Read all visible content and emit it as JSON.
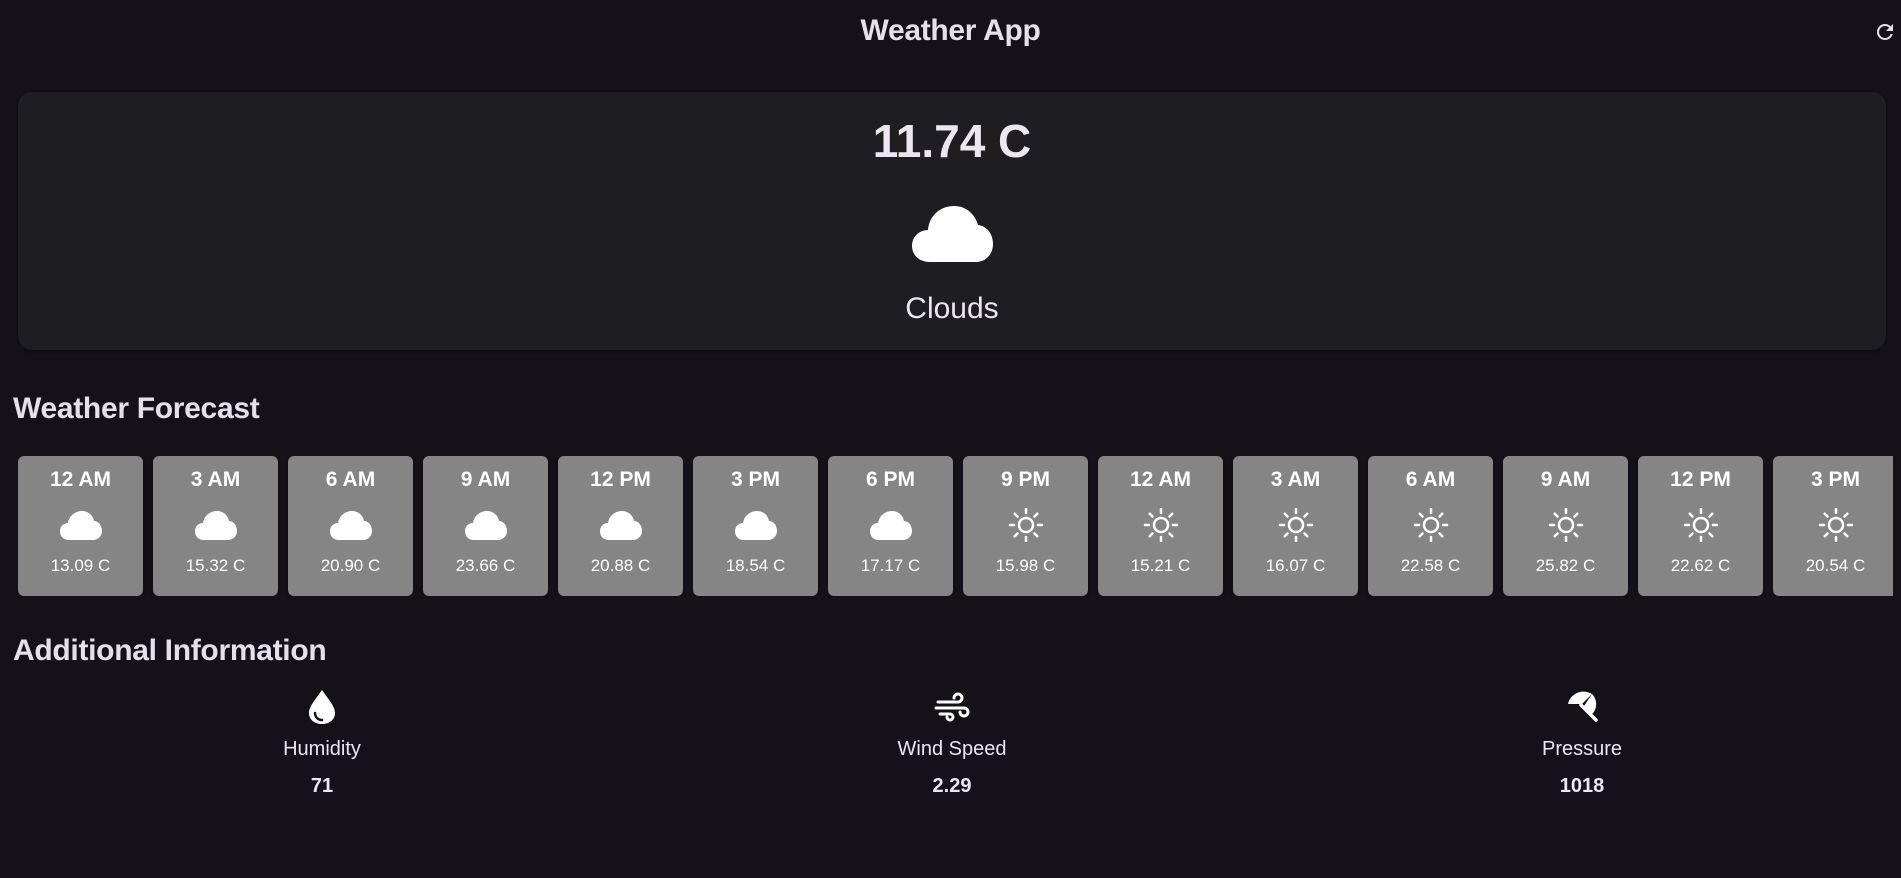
{
  "app": {
    "title": "Weather App"
  },
  "current": {
    "temperature": "11.74 C",
    "condition": "Clouds",
    "icon": "cloud-icon"
  },
  "forecast": {
    "title": "Weather Forecast",
    "items": [
      {
        "time": "12 AM",
        "icon": "cloud",
        "temp": "13.09 C"
      },
      {
        "time": "3 AM",
        "icon": "cloud",
        "temp": "15.32 C"
      },
      {
        "time": "6 AM",
        "icon": "cloud",
        "temp": "20.90 C"
      },
      {
        "time": "9 AM",
        "icon": "cloud",
        "temp": "23.66 C"
      },
      {
        "time": "12 PM",
        "icon": "cloud",
        "temp": "20.88 C"
      },
      {
        "time": "3 PM",
        "icon": "cloud",
        "temp": "18.54 C"
      },
      {
        "time": "6 PM",
        "icon": "cloud",
        "temp": "17.17 C"
      },
      {
        "time": "9 PM",
        "icon": "sun",
        "temp": "15.98 C"
      },
      {
        "time": "12 AM",
        "icon": "sun",
        "temp": "15.21 C"
      },
      {
        "time": "3 AM",
        "icon": "sun",
        "temp": "16.07 C"
      },
      {
        "time": "6 AM",
        "icon": "sun",
        "temp": "22.58 C"
      },
      {
        "time": "9 AM",
        "icon": "sun",
        "temp": "25.82 C"
      },
      {
        "time": "12 PM",
        "icon": "sun",
        "temp": "22.62 C"
      },
      {
        "time": "3 PM",
        "icon": "sun",
        "temp": "20.54 C"
      }
    ]
  },
  "additional": {
    "title": "Additional Information",
    "humidity": {
      "label": "Humidity",
      "value": "71",
      "icon": "water-drop-icon"
    },
    "wind": {
      "label": "Wind Speed",
      "value": "2.29",
      "icon": "wind-icon"
    },
    "pressure": {
      "label": "Pressure",
      "value": "1018",
      "icon": "beach-umbrella-icon"
    }
  },
  "colors": {
    "background": "#141218",
    "card": "#1e1d22",
    "forecast_card": "#858585",
    "text": "#e6e0e9"
  }
}
